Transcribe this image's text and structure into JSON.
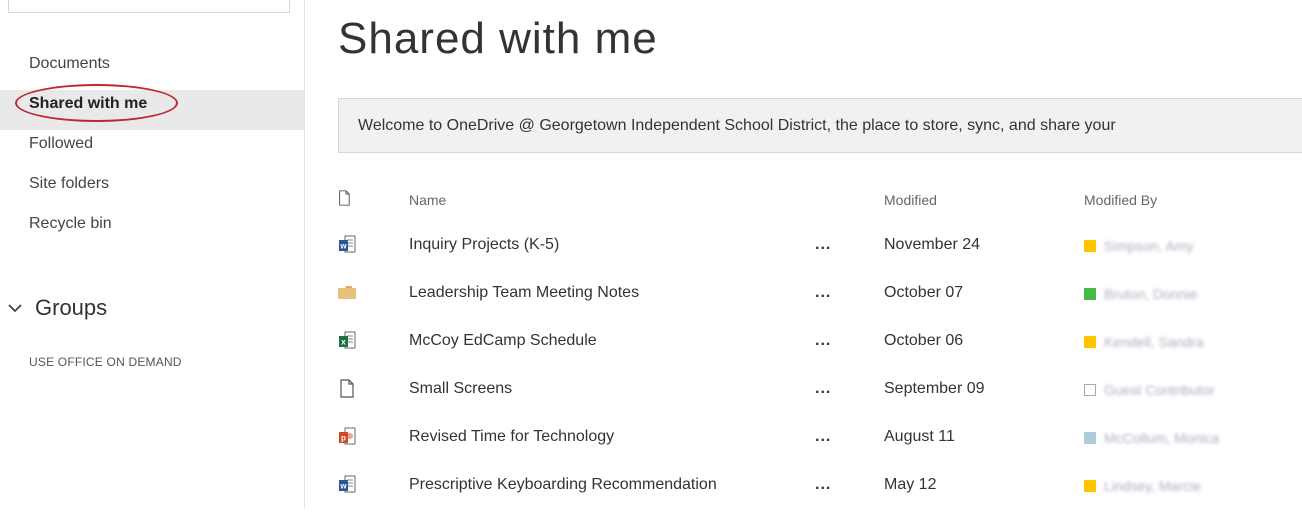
{
  "sidebar": {
    "items": [
      {
        "label": "Documents",
        "active": false
      },
      {
        "label": "Shared with me",
        "active": true
      },
      {
        "label": "Followed",
        "active": false
      },
      {
        "label": "Site folders",
        "active": false
      },
      {
        "label": "Recycle bin",
        "active": false
      }
    ],
    "groups_label": "Groups",
    "office_on_demand_label": "USE OFFICE ON DEMAND"
  },
  "main": {
    "title": "Shared with me",
    "banner": "Welcome to OneDrive @ Georgetown Independent School District, the place to store, sync, and share your"
  },
  "table": {
    "headers": {
      "icon": "file-icon",
      "name": "Name",
      "modified": "Modified",
      "modified_by": "Modified By"
    },
    "more_label": "...",
    "rows": [
      {
        "icon": "word-doc-icon",
        "name": "Inquiry Projects (K-5)",
        "modified": "November 24",
        "modified_by": "Simpson, Amy",
        "status_color": "#ffc600"
      },
      {
        "icon": "folder-icon",
        "name": "Leadership Team Meeting Notes",
        "modified": "October 07",
        "modified_by": "Bruton, Donnie",
        "status_color": "#44bb44"
      },
      {
        "icon": "excel-doc-icon",
        "name": "McCoy EdCamp Schedule",
        "modified": "October 06",
        "modified_by": "Kendell, Sandra",
        "status_color": "#ffc600"
      },
      {
        "icon": "generic-file-icon",
        "name": "Small Screens",
        "modified": "September 09",
        "modified_by": "Guest Contributor",
        "status_color": "#ffffff"
      },
      {
        "icon": "powerpoint-doc-icon",
        "name": "Revised Time for Technology",
        "modified": "August 11",
        "modified_by": "McCollum, Monica",
        "status_color": "#b0ccd8"
      },
      {
        "icon": "word-doc-icon",
        "name": "Prescriptive Keyboarding Recommendation",
        "modified": "May 12",
        "modified_by": "Lindsey, Marcie",
        "status_color": "#ffc600"
      }
    ]
  },
  "colors": {
    "annotation_circle": "#c0262d",
    "active_nav_bg": "#e9e9e9",
    "word_blue": "#2b5797",
    "excel_green": "#1e7145",
    "powerpoint_red": "#d24726",
    "folder_tan": "#e8c27b"
  }
}
